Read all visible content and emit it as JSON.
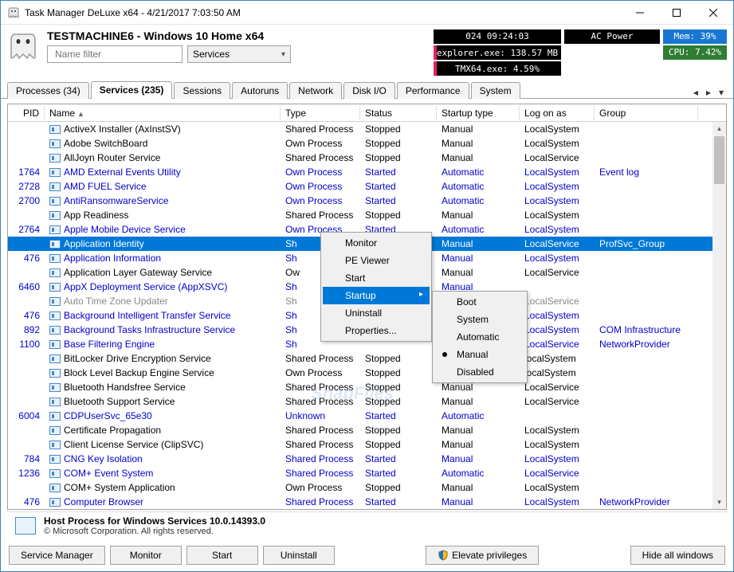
{
  "window": {
    "title": "Task Manager DeLuxe x64 - 4/21/2017 7:03:50 AM"
  },
  "header": {
    "machine": "TESTMACHINE6 - Windows 10 Home x64",
    "filter_placeholder": "Name filter",
    "filter_combo": "Services"
  },
  "stats": {
    "uptime": "024 09:24:03",
    "power": "AC Power",
    "proc1": "explorer.exe: 138.57 MB",
    "proc2": "TMX64.exe:  4.59%",
    "mem": "Mem: 39%",
    "cpu": "CPU: 7.42%"
  },
  "tabs": [
    "Processes (34)",
    "Services (235)",
    "Sessions",
    "Autoruns",
    "Network",
    "Disk I/O",
    "Performance",
    "System"
  ],
  "columns": [
    "PID",
    "Name",
    "Type",
    "Status",
    "Startup type",
    "Log on as",
    "Group"
  ],
  "rows": [
    {
      "pid": "",
      "name": "ActiveX Installer (AxInstSV)",
      "type": "Shared Process",
      "status": "Stopped",
      "startup": "Manual",
      "logon": "LocalSystem",
      "group": "",
      "cls": ""
    },
    {
      "pid": "",
      "name": "Adobe SwitchBoard",
      "type": "Own Process",
      "status": "Stopped",
      "startup": "Manual",
      "logon": "LocalSystem",
      "group": "",
      "cls": ""
    },
    {
      "pid": "",
      "name": "AllJoyn Router Service",
      "type": "Shared Process",
      "status": "Stopped",
      "startup": "Manual",
      "logon": "LocalService",
      "group": "",
      "cls": ""
    },
    {
      "pid": "1764",
      "name": "AMD External Events Utility",
      "type": "Own Process",
      "status": "Started",
      "startup": "Automatic",
      "logon": "LocalSystem",
      "group": "Event log",
      "cls": "blue"
    },
    {
      "pid": "2728",
      "name": "AMD FUEL Service",
      "type": "Own Process",
      "status": "Started",
      "startup": "Automatic",
      "logon": "LocalSystem",
      "group": "",
      "cls": "blue"
    },
    {
      "pid": "2700",
      "name": "AntiRansomwareService",
      "type": "Own Process",
      "status": "Started",
      "startup": "Automatic",
      "logon": "LocalSystem",
      "group": "",
      "cls": "blue"
    },
    {
      "pid": "",
      "name": "App Readiness",
      "type": "Shared Process",
      "status": "Stopped",
      "startup": "Manual",
      "logon": "LocalSystem",
      "group": "",
      "cls": ""
    },
    {
      "pid": "2764",
      "name": "Apple Mobile Device Service",
      "type": "Own Process",
      "status": "Started",
      "startup": "Automatic",
      "logon": "LocalSystem",
      "group": "",
      "cls": "blue"
    },
    {
      "pid": "",
      "name": "Application Identity",
      "type": "Sh",
      "status": "",
      "startup": "Manual",
      "logon": "LocalService",
      "group": "ProfSvc_Group",
      "cls": "selected"
    },
    {
      "pid": "476",
      "name": "Application Information",
      "type": "Sh",
      "status": "",
      "startup": "Manual",
      "logon": "LocalSystem",
      "group": "",
      "cls": "blue"
    },
    {
      "pid": "",
      "name": "Application Layer Gateway Service",
      "type": "Ow",
      "status": "",
      "startup": "Manual",
      "logon": "LocalService",
      "group": "",
      "cls": ""
    },
    {
      "pid": "6460",
      "name": "AppX Deployment Service (AppXSVC)",
      "type": "Sh",
      "status": "",
      "startup": "Manual",
      "logon": "",
      "group": "",
      "cls": "blue"
    },
    {
      "pid": "",
      "name": "Auto Time Zone Updater",
      "type": "Sh",
      "status": "",
      "startup": "",
      "logon": "LocalService",
      "group": "",
      "cls": "gray"
    },
    {
      "pid": "476",
      "name": "Background Intelligent Transfer Service",
      "type": "Sh",
      "status": "",
      "startup": "",
      "logon": "LocalSystem",
      "group": "",
      "cls": "blue"
    },
    {
      "pid": "892",
      "name": "Background Tasks Infrastructure Service",
      "type": "Sh",
      "status": "",
      "startup": "",
      "logon": "LocalSystem",
      "group": "COM Infrastructure",
      "cls": "blue"
    },
    {
      "pid": "1100",
      "name": "Base Filtering Engine",
      "type": "Sh",
      "status": "",
      "startup": "",
      "logon": "LocalService",
      "group": "NetworkProvider",
      "cls": "blue"
    },
    {
      "pid": "",
      "name": "BitLocker Drive Encryption Service",
      "type": "Shared Process",
      "status": "Stopped",
      "startup": "",
      "logon": "localSystem",
      "group": "",
      "cls": ""
    },
    {
      "pid": "",
      "name": "Block Level Backup Engine Service",
      "type": "Own Process",
      "status": "Stopped",
      "startup": "",
      "logon": "localSystem",
      "group": "",
      "cls": ""
    },
    {
      "pid": "",
      "name": "Bluetooth Handsfree Service",
      "type": "Shared Process",
      "status": "Stopped",
      "startup": "Manual",
      "logon": "LocalService",
      "group": "",
      "cls": ""
    },
    {
      "pid": "",
      "name": "Bluetooth Support Service",
      "type": "Shared Process",
      "status": "Stopped",
      "startup": "Manual",
      "logon": "LocalService",
      "group": "",
      "cls": ""
    },
    {
      "pid": "6004",
      "name": "CDPUserSvc_65e30",
      "type": "Unknown",
      "status": "Started",
      "startup": "Automatic",
      "logon": "",
      "group": "",
      "cls": "blue"
    },
    {
      "pid": "",
      "name": "Certificate Propagation",
      "type": "Shared Process",
      "status": "Stopped",
      "startup": "Manual",
      "logon": "LocalSystem",
      "group": "",
      "cls": ""
    },
    {
      "pid": "",
      "name": "Client License Service (ClipSVC)",
      "type": "Shared Process",
      "status": "Stopped",
      "startup": "Manual",
      "logon": "LocalSystem",
      "group": "",
      "cls": ""
    },
    {
      "pid": "784",
      "name": "CNG Key Isolation",
      "type": "Shared Process",
      "status": "Started",
      "startup": "Manual",
      "logon": "LocalSystem",
      "group": "",
      "cls": "blue"
    },
    {
      "pid": "1236",
      "name": "COM+ Event System",
      "type": "Shared Process",
      "status": "Started",
      "startup": "Automatic",
      "logon": "LocalService",
      "group": "",
      "cls": "blue"
    },
    {
      "pid": "",
      "name": "COM+ System Application",
      "type": "Own Process",
      "status": "Stopped",
      "startup": "Manual",
      "logon": "LocalSystem",
      "group": "",
      "cls": ""
    },
    {
      "pid": "476",
      "name": "Computer Browser",
      "type": "Shared Process",
      "status": "Started",
      "startup": "Manual",
      "logon": "LocalSystem",
      "group": "NetworkProvider",
      "cls": "blue"
    }
  ],
  "context_menu": [
    "Monitor",
    "PE Viewer",
    "Start",
    "Startup",
    "Uninstall",
    "Properties..."
  ],
  "submenu": [
    "Boot",
    "System",
    "Automatic",
    "Manual",
    "Disabled"
  ],
  "statusbar": {
    "title": "Host Process for Windows Services 10.0.14393.0",
    "sub": "© Microsoft Corporation. All rights reserved."
  },
  "buttons": {
    "service_manager": "Service Manager",
    "monitor": "Monitor",
    "start": "Start",
    "uninstall": "Uninstall",
    "elevate": "Elevate privileges",
    "hide_all": "Hide all windows"
  },
  "watermark": "SnapFiles"
}
